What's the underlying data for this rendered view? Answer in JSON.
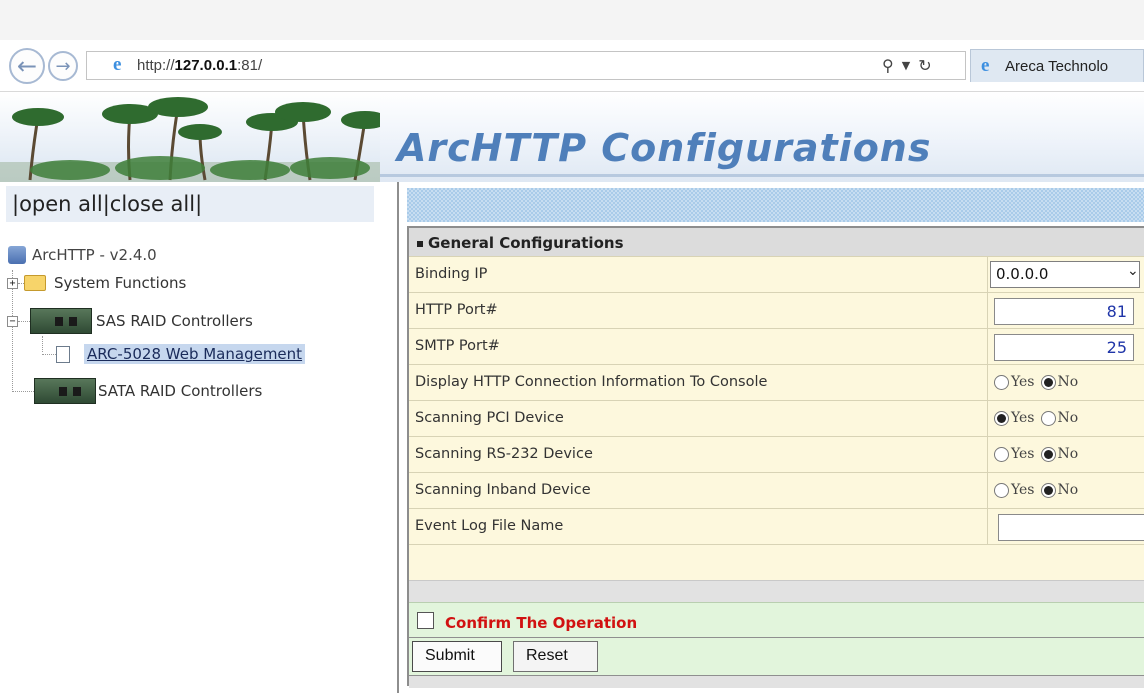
{
  "browser": {
    "url_prefix": "http://",
    "url_host": "127.0.0.1",
    "url_suffix": ":81/",
    "search_icon": "search-icon",
    "dropdown_icon": "chevron-down-icon",
    "refresh_icon": "refresh-icon",
    "tab_title": "Areca Technolo"
  },
  "banner": {
    "title": "ArcHTTP Configurations"
  },
  "tree": {
    "open_all": "open all",
    "close_all": "close all",
    "root": "ArcHTTP - v2.4.0",
    "items": [
      {
        "label": "System Functions"
      },
      {
        "label": "SAS RAID Controllers"
      },
      {
        "label": "ARC-5028 Web Management"
      },
      {
        "label": "SATA RAID Controllers"
      }
    ]
  },
  "form": {
    "section_title": "General Configurations",
    "binding_ip": {
      "label": "Binding IP",
      "value": "0.0.0.0"
    },
    "http_port": {
      "label": "HTTP Port#",
      "value": "81"
    },
    "smtp_port": {
      "label": "SMTP Port#",
      "value": "25"
    },
    "display_http": {
      "label": "Display HTTP Connection Information To Console",
      "selected": "No"
    },
    "scan_pci": {
      "label": "Scanning PCI Device",
      "selected": "Yes"
    },
    "scan_rs232": {
      "label": "Scanning RS-232 Device",
      "selected": "No"
    },
    "scan_inband": {
      "label": "Scanning Inband Device",
      "selected": "No"
    },
    "event_log": {
      "label": "Event Log File Name",
      "value": ""
    },
    "yes_label": "Yes",
    "no_label": "No",
    "confirm_label": "Confirm The Operation",
    "submit_label": "Submit",
    "reset_label": "Reset"
  },
  "colors": {
    "banner_title": "#4f7fba",
    "form_row_bg": "#fdf8dd",
    "confirm_bg": "#e2f5dc",
    "confirm_text": "#d11111",
    "port_value": "#1f35a8"
  }
}
